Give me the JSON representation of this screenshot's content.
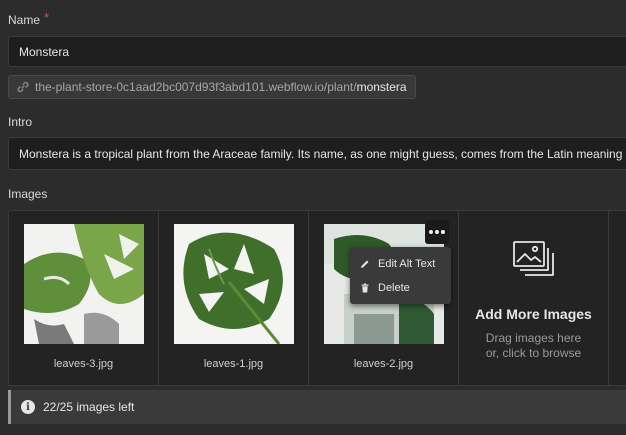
{
  "name_field": {
    "label": "Name",
    "required_mark": "*",
    "value": "Monstera"
  },
  "slug": {
    "prefix": "the-plant-store-0c1aad2bc007d93f3abd101.webflow.io/plant/",
    "value": "monstera"
  },
  "intro_field": {
    "label": "Intro",
    "value": "Monstera is a tropical plant from the Araceae family. Its name, as one might guess, comes from the Latin meaning"
  },
  "images": {
    "label": "Images",
    "items": [
      {
        "filename": "leaves-3.jpg"
      },
      {
        "filename": "leaves-1.jpg"
      },
      {
        "filename": "leaves-2.jpg"
      }
    ],
    "add_more": {
      "title": "Add More Images",
      "line1": "Drag images here",
      "line2": "or, click to browse"
    },
    "menu": {
      "edit_alt": "Edit Alt Text",
      "delete": "Delete"
    },
    "info": "22/25 images left"
  }
}
